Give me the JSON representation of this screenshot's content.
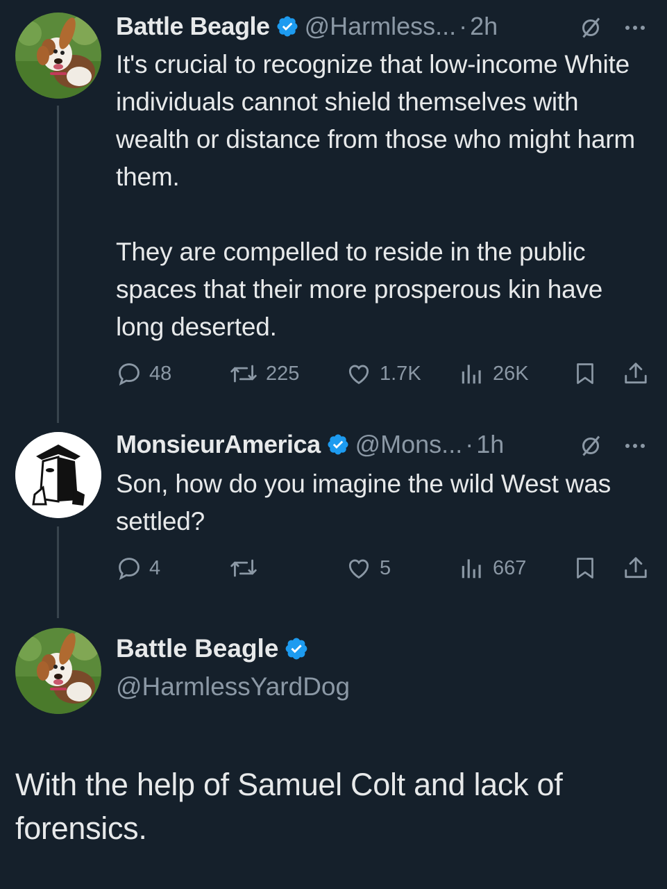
{
  "tweets": [
    {
      "author_name": "Battle Beagle",
      "handle": "@Harmless...",
      "separator": "·",
      "time": "2h",
      "text_paragraphs": [
        "It's crucial to recognize that low-income White individuals cannot shield themselves with wealth or distance from those who might harm them.",
        "They are compelled to reside in the public spaces that their more prosperous kin have long deserted."
      ],
      "stats": {
        "replies": "48",
        "reposts": "225",
        "likes": "1.7K",
        "views": "26K"
      }
    },
    {
      "author_name": "MonsieurAmerica",
      "handle": "@Mons...",
      "separator": "·",
      "time": "1h",
      "text": "Son, how do you imagine the wild West was settled?",
      "stats": {
        "replies": "4",
        "reposts": "",
        "likes": "5",
        "views": "667"
      }
    }
  ],
  "main_tweet": {
    "author_name": "Battle Beagle",
    "handle": "@HarmlessYardDog",
    "text": "With the help of Samuel Colt and lack of forensics."
  },
  "colors": {
    "background": "#15202b",
    "text": "#e7e9ea",
    "secondary": "#8b98a5",
    "verified": "#1d9bf0",
    "thread_line": "#38444d"
  },
  "icons": [
    "verified-badge-icon",
    "grok-icon",
    "more-icon",
    "reply-icon",
    "repost-icon",
    "like-icon",
    "views-icon",
    "bookmark-icon",
    "share-icon"
  ]
}
